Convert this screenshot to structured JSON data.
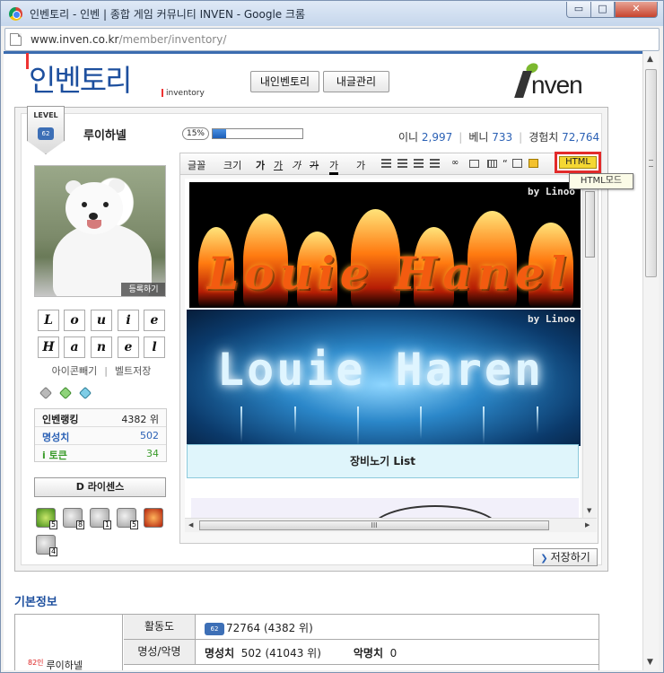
{
  "window": {
    "title": "인벤토리 - 인벤 | 종합 게임 커뮤니티 INVEN - Google 크롬",
    "url_host": "www.inven.co.kr",
    "url_path": "/member/inventory/",
    "min_glyph": "▭",
    "max_glyph": "□",
    "close_glyph": "✕"
  },
  "header": {
    "logo_text": "인벤토리",
    "logo_sub": "inventory",
    "my_inventory_label": "내인벤토리",
    "my_posts_label": "내글관리",
    "brand_text": "nven"
  },
  "profile": {
    "level_label": "LEVEL",
    "level_value": "62",
    "username": "루이하넬",
    "progress_label": "15%",
    "progress_pct": 15,
    "stats": [
      {
        "label": "이니",
        "value": "2,997"
      },
      {
        "label": "베니",
        "value": "733"
      },
      {
        "label": "경험치",
        "value": "72,764"
      }
    ],
    "register_label": "등록하기",
    "letters": [
      "L",
      "o",
      "u",
      "i",
      "e",
      "H",
      "a",
      "n",
      "e",
      "l"
    ],
    "icon_remove_label": "아이콘빼기",
    "belt_save_label": "벨트저장",
    "ranks": [
      {
        "label": "인벤랭킹",
        "value": "4382 위",
        "color": "#222222"
      },
      {
        "label": "명성치",
        "value": "502",
        "color": "#2b61b5"
      },
      {
        "label": "i 토큰",
        "value": "34",
        "color": "#3a9b2a"
      }
    ],
    "license_label": "D  라이센스",
    "badges": [
      "5",
      "8",
      "1",
      "5",
      "",
      "4"
    ]
  },
  "editor": {
    "toolbar": {
      "font_label": "글꼴",
      "size_label": "크기",
      "b_label": "가",
      "u_label": "가",
      "i_label": "가",
      "s_label": "가",
      "color_label": "가",
      "bg_label": "가",
      "quote_label": "“",
      "html_label": "HTML",
      "html_tooltip": "HTML모드"
    },
    "banner1_text": "Louie Hanel",
    "banner1_credit": "by Linoo",
    "banner2_text": "Louie Haren",
    "banner2_credit": "by Linoo",
    "list_title": "장비노기 List",
    "hscroll_grip": "III"
  },
  "save_label": "저장하기",
  "basic_info": {
    "title": "기본정보",
    "name_tag": "82인",
    "name": "루이하넬",
    "activity_label": "활동도",
    "activity_level": "62",
    "activity_value": "72764 (4382 위)",
    "fame_label": "명성/악명",
    "fame_name": "명성치",
    "fame_value": "502 (41043 위)",
    "infamy_name": "악명치",
    "infamy_value": "0"
  }
}
